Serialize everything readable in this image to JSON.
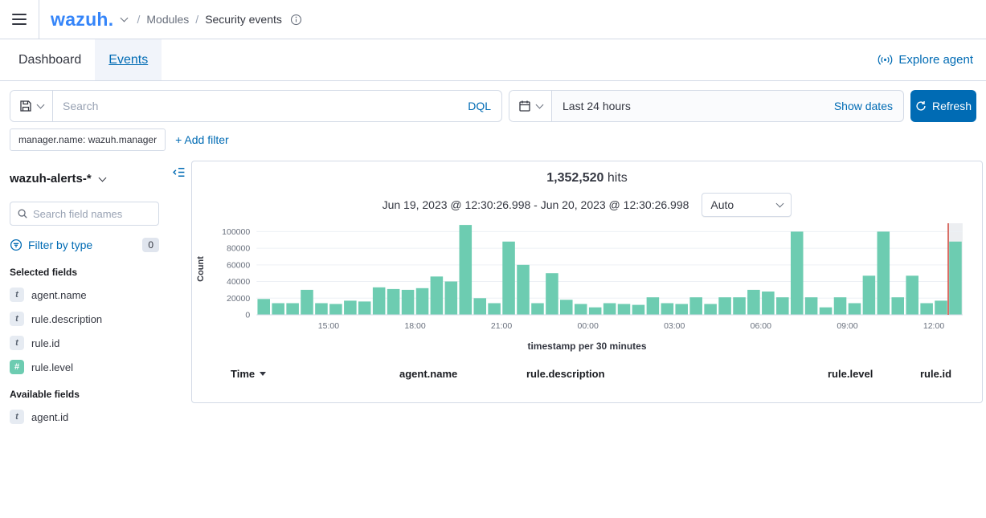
{
  "colors": {
    "accent_blue": "#006bb4",
    "logo_blue": "#3585f9",
    "bar_green": "#6dccb1",
    "marker_red": "#d0453a",
    "border_gray": "#d3dae6"
  },
  "topbar": {
    "logo": "wazuh.",
    "breadcrumb": {
      "separator": "/",
      "section": "Modules",
      "page": "Security events"
    }
  },
  "tabs": {
    "items": [
      {
        "label": "Dashboard",
        "active": false
      },
      {
        "label": "Events",
        "active": true
      }
    ],
    "explore_agent": "Explore agent"
  },
  "query": {
    "placeholder": "Search",
    "language": "DQL"
  },
  "datepicker": {
    "time_range": "Last 24 hours",
    "show_dates": "Show dates",
    "refresh": "Refresh"
  },
  "filters": {
    "chips": [
      "manager.name: wazuh.manager"
    ],
    "add_filter": "+ Add filter"
  },
  "sidebar": {
    "index_pattern": "wazuh-alerts-*",
    "field_search_placeholder": "Search field names",
    "filter_by_type": "Filter by type",
    "filter_count": "0",
    "selected_heading": "Selected fields",
    "selected_fields": [
      {
        "type": "t",
        "name": "agent.name"
      },
      {
        "type": "t",
        "name": "rule.description"
      },
      {
        "type": "t",
        "name": "rule.id"
      },
      {
        "type": "#",
        "name": "rule.level"
      }
    ],
    "available_heading": "Available fields",
    "available_fields": [
      {
        "type": "t",
        "name": "agent.id"
      }
    ]
  },
  "chart_data": {
    "type": "bar",
    "hits_count": "1,352,520",
    "hits_label": "hits",
    "subtitle": "Jun 19, 2023 @ 12:30:26.998 - Jun 20, 2023 @ 12:30:26.998",
    "interval_selector": "Auto",
    "ylabel": "Count",
    "xlabel": "timestamp per 30 minutes",
    "ylim": [
      0,
      110000
    ],
    "yticks": [
      0,
      20000,
      40000,
      60000,
      80000,
      100000
    ],
    "x_tick_labels": [
      "15:00",
      "18:00",
      "21:00",
      "00:00",
      "03:00",
      "06:00",
      "09:00",
      "12:00"
    ],
    "x_tick_offsets_hours": [
      2.5,
      5.5,
      8.5,
      11.5,
      14.5,
      17.5,
      20.5,
      23.5
    ],
    "total_hours": 24.5,
    "bucket_minutes": 30,
    "bar_color": "#6dccb1",
    "grid": true,
    "legend": "none",
    "current_time_marker": {
      "color": "#d0453a",
      "at_bucket_index": 48
    },
    "values": [
      19000,
      14000,
      14000,
      30000,
      14000,
      13000,
      17000,
      16000,
      33000,
      31000,
      30000,
      32000,
      46000,
      40000,
      108000,
      20000,
      14000,
      88000,
      60000,
      14000,
      50000,
      18000,
      13000,
      9000,
      14000,
      13000,
      12000,
      21000,
      14000,
      13000,
      21000,
      13000,
      21000,
      21000,
      30000,
      28000,
      21000,
      100000,
      21000,
      9000,
      21000,
      14000,
      47000,
      100000,
      21000,
      47000,
      14000,
      17000,
      88000
    ]
  },
  "table": {
    "columns": [
      {
        "label": "Time",
        "sorted": "desc"
      },
      {
        "label": "agent.name"
      },
      {
        "label": "rule.description"
      },
      {
        "label": "rule.level"
      },
      {
        "label": "rule.id"
      }
    ]
  }
}
